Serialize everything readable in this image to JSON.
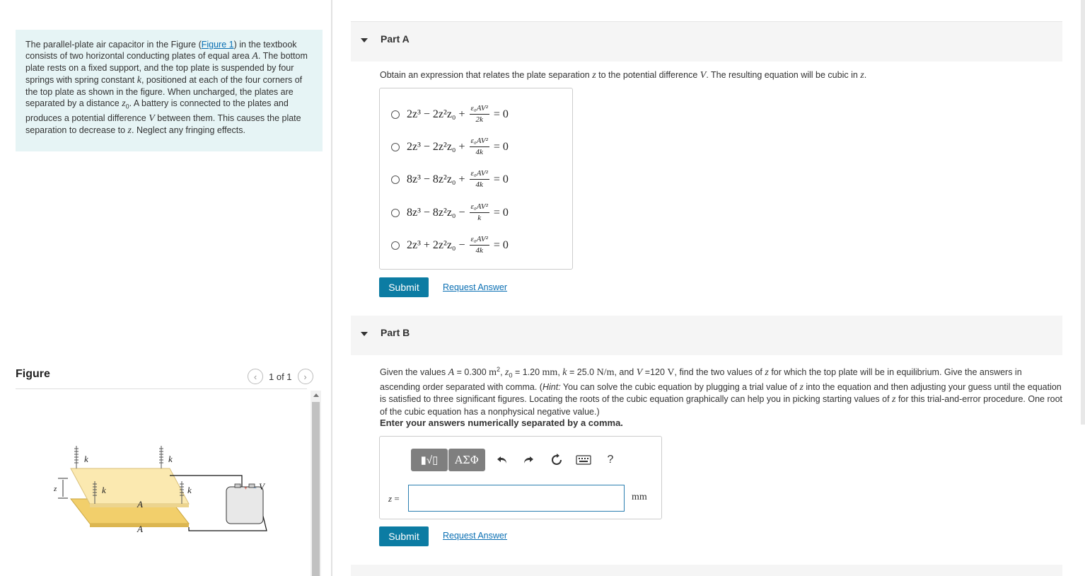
{
  "problem": {
    "text_segments": [
      "The parallel-plate air capacitor in the Figure (",
      "Figure 1",
      ") in the textbook consists of two horizontal conducting plates of equal area ",
      "A",
      ". The bottom plate rests on a fixed support, and the top plate is suspended by four springs with spring constant ",
      "k",
      ", positioned at each of the four corners of the top plate as shown in the figure. When uncharged, the plates are separated by a distance ",
      "z",
      "0",
      ". A battery is connected to the plates and produces a potential difference ",
      "V",
      " between them. This causes the plate separation to decrease to ",
      "z",
      ". Neglect any fringing effects."
    ]
  },
  "figure": {
    "title": "Figure",
    "pager": {
      "current_label": "1 of 1",
      "prev_icon": "chevron-left-icon",
      "next_icon": "chevron-right-icon"
    },
    "labels": {
      "k1": "k",
      "k2": "k",
      "k3": "k",
      "k4": "k",
      "a_top": "A",
      "a_bottom": "A",
      "z": "z",
      "v": "V"
    },
    "colors": {
      "top_plate": "#fbe9b0",
      "bottom_plate": "#f2cf6b",
      "battery": "#e8e8e8"
    }
  },
  "part_a": {
    "title": "Part A",
    "question_segments": [
      "Obtain an expression that relates the plate separation ",
      "z",
      " to the potential difference ",
      "V",
      ". The resulting equation will be cubic in ",
      "z",
      "."
    ],
    "options": [
      {
        "lhs": "2z³ − 2z²z₀ +",
        "num": "ε₀AV²",
        "den": "2k",
        "rhs": "= 0"
      },
      {
        "lhs": "2z³ − 2z²z₀ +",
        "num": "ε₀AV²",
        "den": "4k",
        "rhs": "= 0"
      },
      {
        "lhs": "8z³ − 8z²z₀ +",
        "num": "ε₀AV²",
        "den": "4k",
        "rhs": "= 0"
      },
      {
        "lhs": "8z³ − 8z²z₀ −",
        "num": "ε₀AV²",
        "den": "k",
        "rhs": "= 0"
      },
      {
        "lhs": "2z³ + 2z²z₀ −",
        "num": "ε₀AV²",
        "den": "4k",
        "rhs": "= 0"
      }
    ],
    "submit_label": "Submit",
    "request_label": "Request Answer"
  },
  "part_b": {
    "title": "Part B",
    "question_segments": [
      "Given the values ",
      "A",
      " = 0.300 ",
      "m",
      "2",
      ", ",
      "z",
      "0",
      " = 1.20 ",
      "mm",
      ", ",
      "k",
      " = 25.0 ",
      "N/m",
      ", and ",
      "V",
      " =120 ",
      "V",
      ", find the two values of ",
      "z",
      " for which the top plate will be in equilibrium. Give the answers in ascending order separated with comma. (",
      "Hint:",
      " You can solve the cubic equation by plugging a trial value of ",
      "z",
      " into the equation and then adjusting your guess until the equation is satisfied to three significant figures. Locating the roots of the cubic equation graphically can help you in picking starting values of ",
      "z",
      " for this trial-and-error procedure. One root of the cubic equation has a nonphysical negative value.)"
    ],
    "instruction": "Enter your answers numerically separated by a comma.",
    "toolbar": {
      "templates_label": "▮√▯",
      "greek_label": "ΑΣΦ",
      "undo_icon": "undo-icon",
      "redo_icon": "redo-icon",
      "reset_icon": "reset-icon",
      "keyboard_icon": "keyboard-icon",
      "help_label": "?"
    },
    "variable_label": "z",
    "equals": " =",
    "input_value": "",
    "unit": "mm",
    "submit_label": "Submit",
    "request_label": "Request Answer"
  },
  "colors": {
    "accent": "#0c7ca3",
    "link": "#0a6fb3",
    "problem_bg": "#e6f4f5",
    "header_bg": "#f5f5f5"
  }
}
